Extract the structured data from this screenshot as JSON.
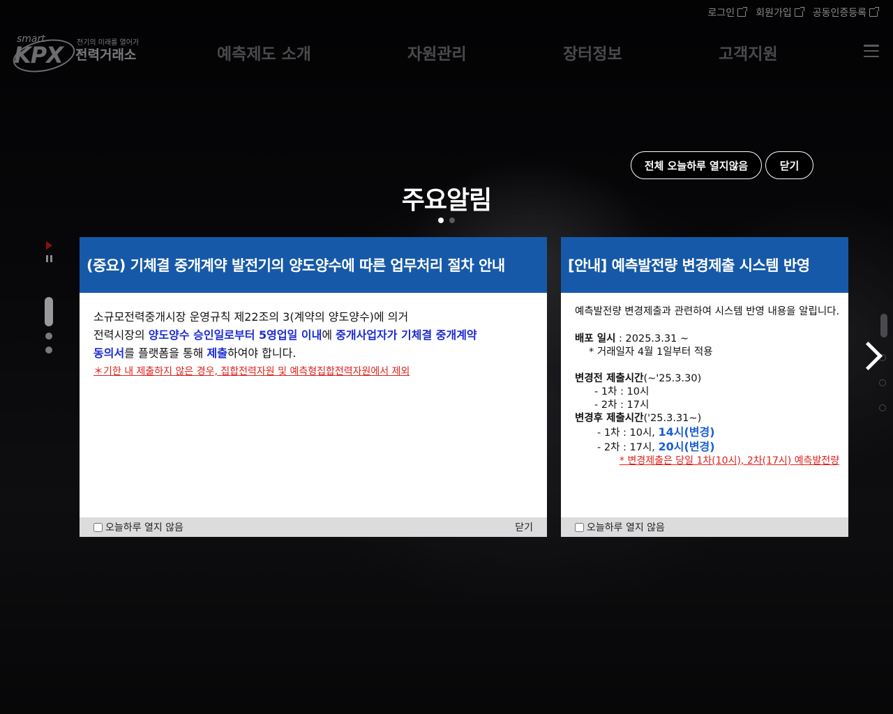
{
  "util_links": [
    {
      "label": "로그인"
    },
    {
      "label": "회원가입"
    },
    {
      "label": "공동인증등록"
    }
  ],
  "logo": {
    "smart": "smart",
    "mark": "KPX",
    "tagline": "전기의 미래를 열어가는",
    "name": "전력거래소"
  },
  "nav": [
    {
      "label": "예측제도 소개"
    },
    {
      "label": "자원관리"
    },
    {
      "label": "장터정보"
    },
    {
      "label": "고객지원"
    }
  ],
  "popup": {
    "title": "주요알림",
    "btn_all_today": "전체 오늘하루 열지않음",
    "btn_close": "닫기"
  },
  "card1": {
    "heading": "(중요) 기체결 중개계약 발전기의 양도양수에 따른 업무처리 절차 안내",
    "line1": "소규모전력중개시장 운영규칙 제22조의 3(계약의 양도양수)에 의거",
    "line2_a": "전력시장의 ",
    "line2_b": "양도양수 승인일로부터 5영업일 이내",
    "line2_c": "에 ",
    "line2_d": "중개사업자가 기체결 중개계약",
    "line3_a": "동의서",
    "line3_b": "를 플랫폼을 통해 ",
    "line3_c": "제출",
    "line3_d": "하여야 합니다.",
    "warning": "＊기한 내 제출하지 않은 경우, 집합전력자원 및 예측형집합전력자원에서 제외",
    "foot_check": "오늘하루 열지 않음",
    "foot_close": "닫기"
  },
  "card2": {
    "heading": "[안내] 예측발전량 변경제출 시스템 반영",
    "intro": "예측발전량 변경제출과 관련하여 시스템 반영 내용을 알립니다.",
    "deploy_label": "배포 일시",
    "deploy_value": " : 2025.3.31 ~",
    "deploy_note": "* 거래일자 4월 1일부터 적용",
    "before_label": "변경전 제출시간",
    "before_range": "(~'25.3.30)",
    "before_1": "-  1차 : 10시",
    "before_2": "-  2차 : 17시",
    "after_label": "변경후 제출시간",
    "after_range": "('25.3.31~)",
    "after_1a": "-  1차 : 10시, ",
    "after_1b": "14시(변경)",
    "after_2a": "-  2차 : 17시, ",
    "after_2b": "20시(변경)",
    "warning": "* 변경제출은 당일 1차(10시), 2차(17시) 예측발전량",
    "foot_check": "오늘하루 열지 않음"
  }
}
